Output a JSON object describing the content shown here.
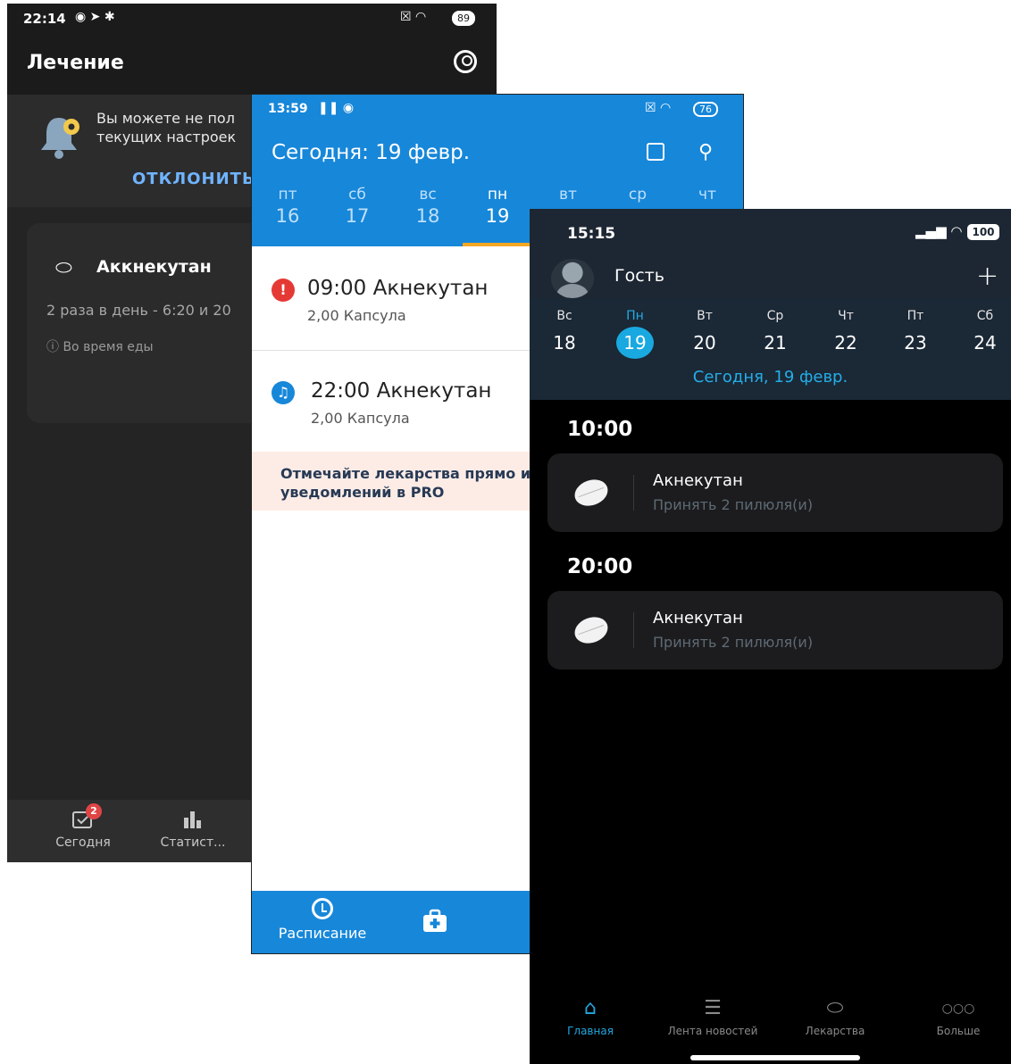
{
  "phone1": {
    "status_time": "22:14",
    "battery": "89",
    "title": "Лечение",
    "banner_text": "Вы можете не пол\nтекущих настроек",
    "dismiss_label": "ОТКЛОНИТЬ",
    "medication": {
      "name": "Аккнекутан",
      "schedule": "2 раза в день - 6:20 и 20",
      "note": "Во время еды"
    },
    "nav": {
      "today_label": "Сегодня",
      "today_badge": "2",
      "stats_label": "Статист..."
    }
  },
  "phone2": {
    "status_time": "13:59",
    "battery": "76",
    "title": "Сегодня: 19 февр.",
    "days": [
      {
        "name": "пт",
        "date": "16"
      },
      {
        "name": "сб",
        "date": "17"
      },
      {
        "name": "вс",
        "date": "18"
      },
      {
        "name": "пн",
        "date": "19"
      },
      {
        "name": "вт",
        "date": ""
      },
      {
        "name": "ср",
        "date": ""
      },
      {
        "name": "чт",
        "date": ""
      }
    ],
    "doses": [
      {
        "time": "09:00",
        "name": "Акнекутан",
        "qty": "2,00 Капсула",
        "icon": "alert-icon",
        "color": "#e53935"
      },
      {
        "time": "22:00",
        "name": "Акнекутан",
        "qty": "2,00 Капсула",
        "icon": "bell-icon",
        "color": "#1787d9"
      }
    ],
    "promo_text": "Отмечайте лекарства прямо и\nуведомлений в PRO",
    "tab_schedule": "Расписание"
  },
  "phone3": {
    "status_time": "15:15",
    "battery": "100",
    "user_name": "Гость",
    "plus": "+",
    "week": [
      {
        "name": "Вс",
        "date": "18"
      },
      {
        "name": "Пн",
        "date": "19"
      },
      {
        "name": "Вт",
        "date": "20"
      },
      {
        "name": "Ср",
        "date": "21"
      },
      {
        "name": "Чт",
        "date": "22"
      },
      {
        "name": "Пт",
        "date": "23"
      },
      {
        "name": "Сб",
        "date": "24"
      }
    ],
    "today_label": "Сегодня, 19 февр.",
    "slots": [
      {
        "time": "10:00",
        "name": "Акнекутан",
        "instruction": "Принять 2 пилюля(и)"
      },
      {
        "time": "20:00",
        "name": "Акнекутан",
        "instruction": "Принять 2 пилюля(и)"
      }
    ],
    "tabs": [
      {
        "label": "Главная",
        "icon": "home-icon"
      },
      {
        "label": "Лента новостей",
        "icon": "news-icon"
      },
      {
        "label": "Лекарства",
        "icon": "pill-icon"
      },
      {
        "label": "Больше",
        "icon": "more-icon"
      }
    ],
    "accent": "#23a7e0"
  }
}
